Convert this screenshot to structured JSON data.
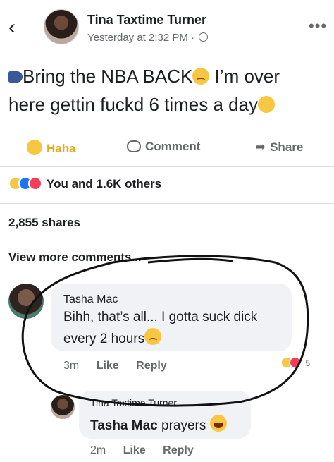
{
  "header": {
    "back_icon": "chevron-left-icon",
    "author": "Tina Taxtime Turner",
    "meta": "Yesterday at 2:32 PM ·",
    "more_label": "•••"
  },
  "post": {
    "line1_a": "Bring the NBA BACK",
    "line1_b": " I’m over",
    "line2": "here gettin fuckd  6 times a day"
  },
  "actions": {
    "haha": "Haha",
    "comment": "Comment",
    "share": "Share"
  },
  "reactions": {
    "text": "You and 1.6K others"
  },
  "shares": "2,855 shares",
  "view_more": "View more comments...",
  "comments": [
    {
      "name": "Tasha Mac",
      "line1": "Bihh, that’s all... I gotta suck dick",
      "line2": "every 2 hours",
      "time": "3m",
      "like": "Like",
      "reply": "Reply",
      "reaction_count": "5"
    }
  ],
  "reply": {
    "name": "Tina Taxtime Turner",
    "mention": "Tasha Mac",
    "text": " prayers",
    "time": "2m",
    "like": "Like",
    "reply": "Reply"
  }
}
